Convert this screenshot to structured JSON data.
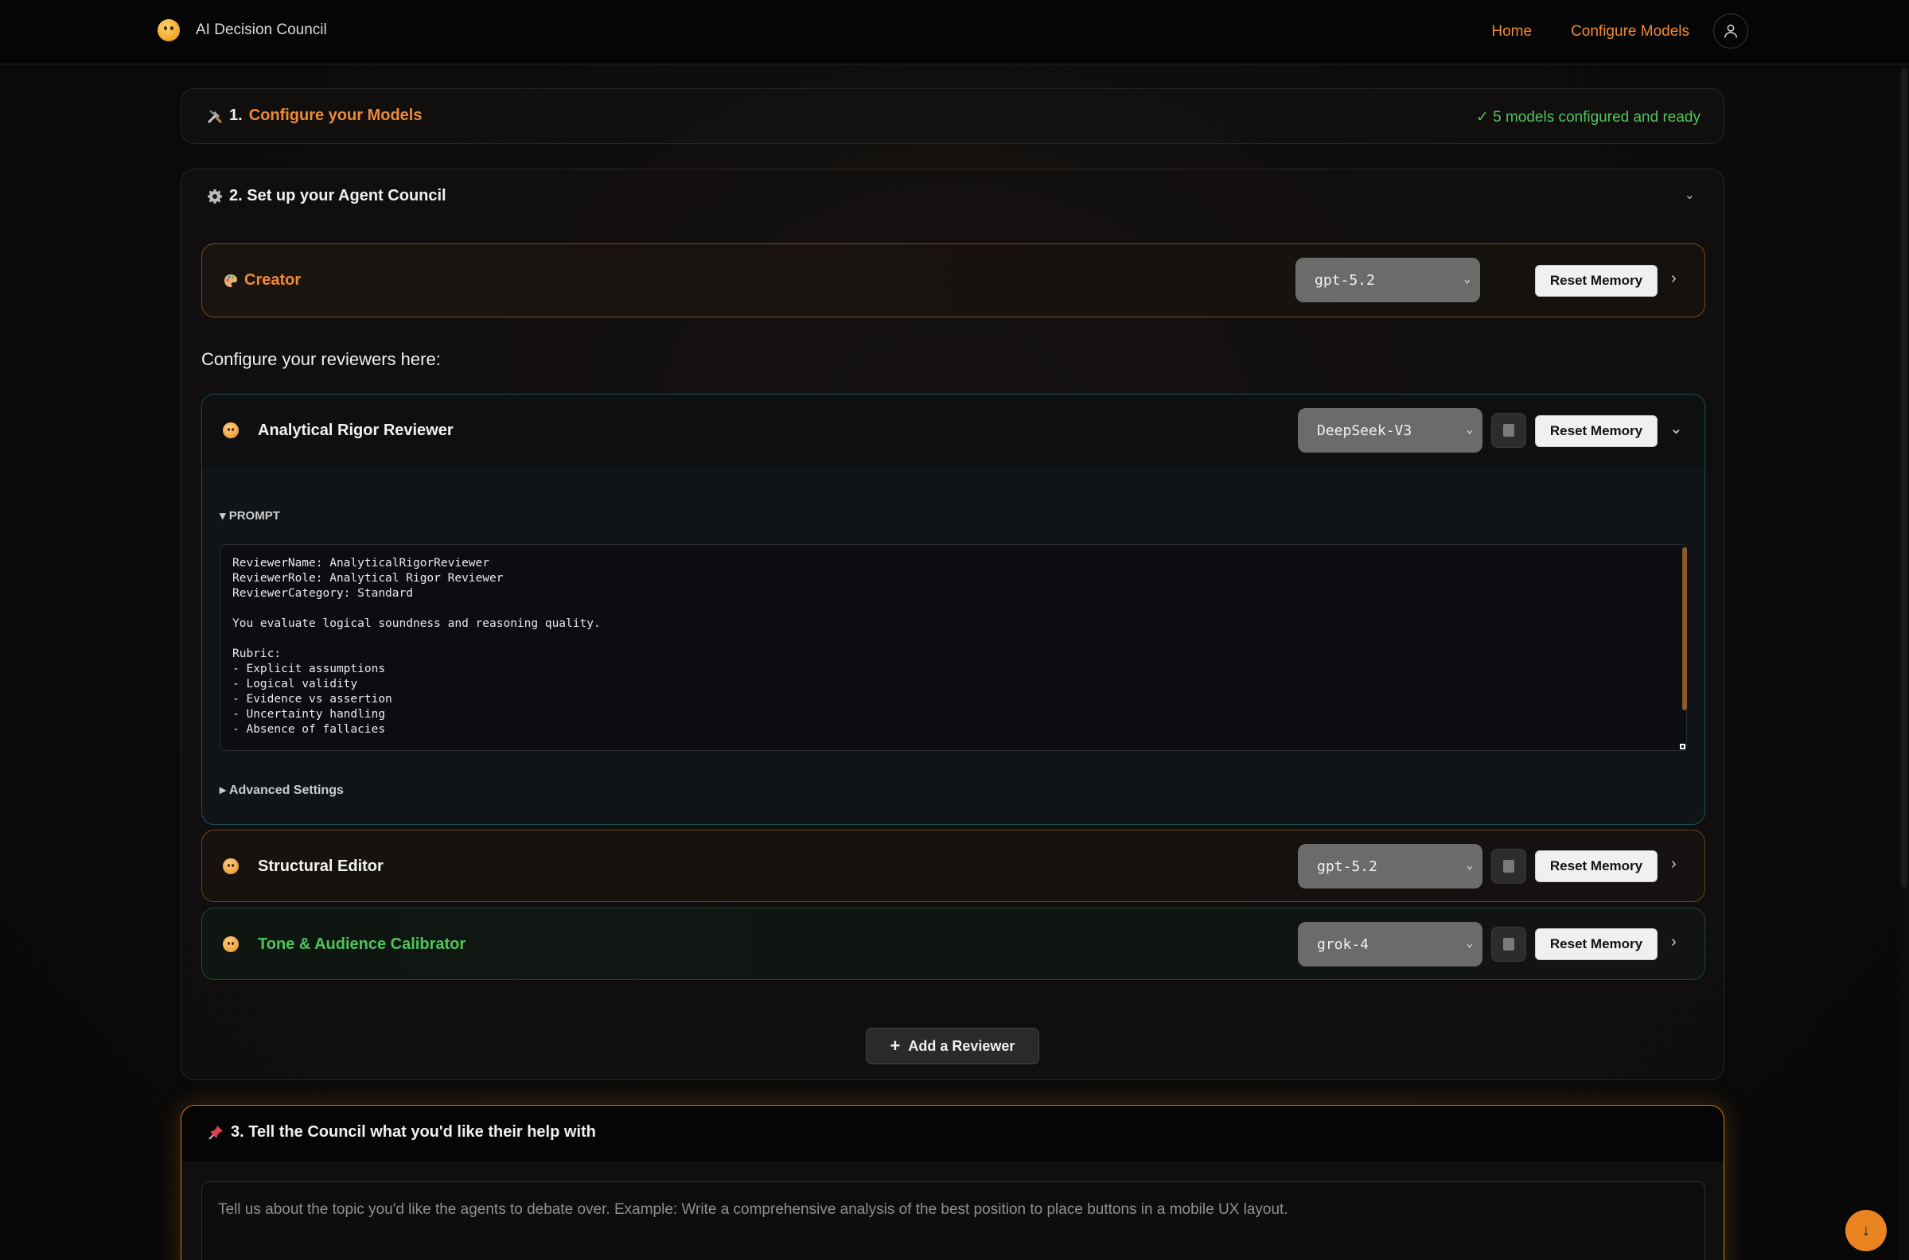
{
  "nav": {
    "brand": "AI Decision Council",
    "links": [
      "Home",
      "Configure Models"
    ]
  },
  "section1": {
    "number": "1.",
    "title": "Configure your Models",
    "status": "✓ 5 models configured and ready"
  },
  "section2": {
    "title": "2. Set up your Agent Council",
    "creator": {
      "name": "Creator",
      "model": "gpt-5.2",
      "reset_label": "Reset Memory"
    },
    "reviewers_label": "Configure your reviewers here:",
    "reviewers": [
      {
        "name": "Analytical Rigor Reviewer",
        "model": "DeepSeek-V3",
        "reset_label": "Reset Memory",
        "expanded": true,
        "prompt_label": "PROMPT",
        "prompt_text": "ReviewerName: AnalyticalRigorReviewer\nReviewerRole: Analytical Rigor Reviewer\nReviewerCategory: Standard\n\nYou evaluate logical soundness and reasoning quality.\n\nRubric:\n- Explicit assumptions\n- Logical validity\n- Evidence vs assertion\n- Uncertainty handling\n- Absence of fallacies",
        "advanced_label": "Advanced Settings"
      },
      {
        "name": "Structural Editor",
        "model": "gpt-5.2",
        "reset_label": "Reset Memory"
      },
      {
        "name": "Tone & Audience Calibrator",
        "model": "grok-4",
        "reset_label": "Reset Memory"
      }
    ],
    "add_reviewer_label": "Add a Reviewer"
  },
  "section3": {
    "title": "3. Tell the Council what you'd like their help with",
    "placeholder": "Tell us about the topic you'd like the agents to debate over. Example: Write a comprehensive analysis of the best position to place buttons in a mobile UX layout."
  },
  "colors": {
    "accent": "#ef8a34",
    "success": "#4fc45a",
    "green_name": "#4fc45a"
  }
}
